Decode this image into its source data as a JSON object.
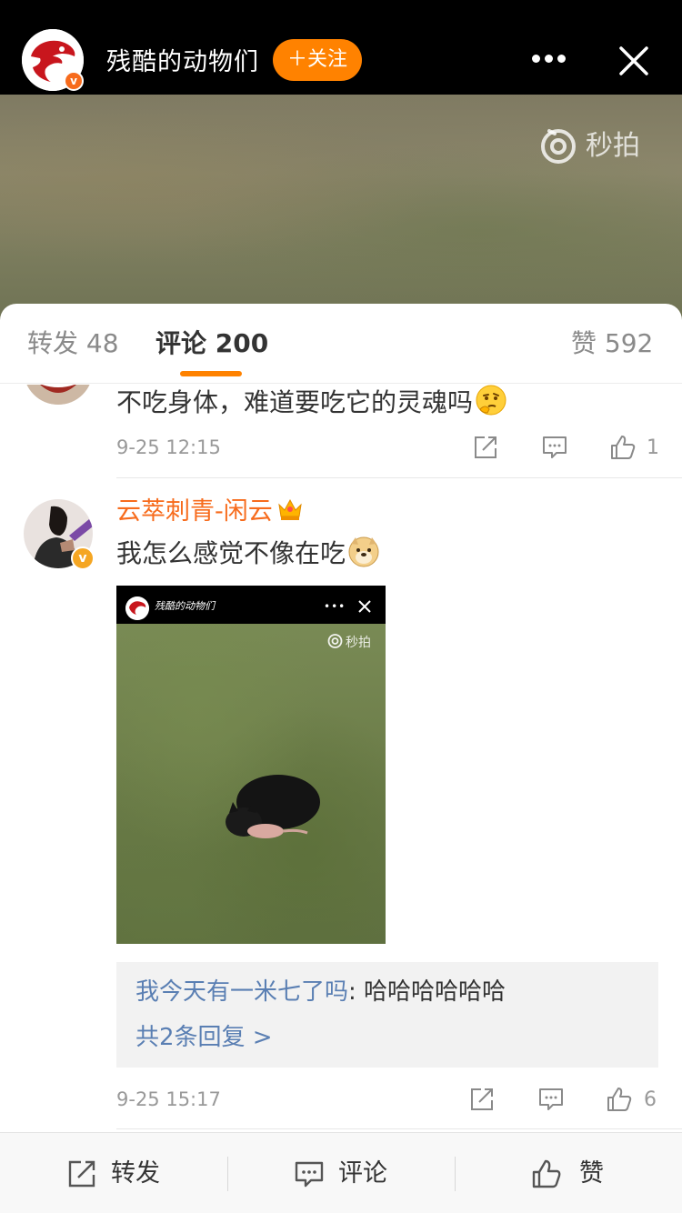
{
  "header": {
    "account_name": "残酷的动物们",
    "follow_label": "＋关注"
  },
  "video": {
    "watermark": "秒拍"
  },
  "tabs": {
    "repost": "转发 48",
    "comments": "评论 200",
    "likes": "赞 592"
  },
  "comments": [
    {
      "text": "不吃身体，难道要吃它的灵魂吗",
      "date": "9-25 12:15",
      "likes": "1",
      "emoji": "thinking-emoji"
    },
    {
      "username": "云萃刺青-闲云",
      "text": "我怎么感觉不像在吃",
      "date": "9-25 15:17",
      "likes": "6",
      "emoji": "doge-emoji",
      "media": {
        "watermark": "秒拍"
      },
      "reply_preview": {
        "user": "我今天有一米七了吗",
        "separator": ": ",
        "text": "哈哈哈哈哈哈",
        "more": "共2条回复 >"
      }
    }
  ],
  "bottom_bar": {
    "repost": "转发",
    "comment": "评论",
    "like": "赞"
  },
  "colors": {
    "accent": "#ff8200",
    "username": "#f76b1c",
    "link": "#5a7fb3"
  }
}
